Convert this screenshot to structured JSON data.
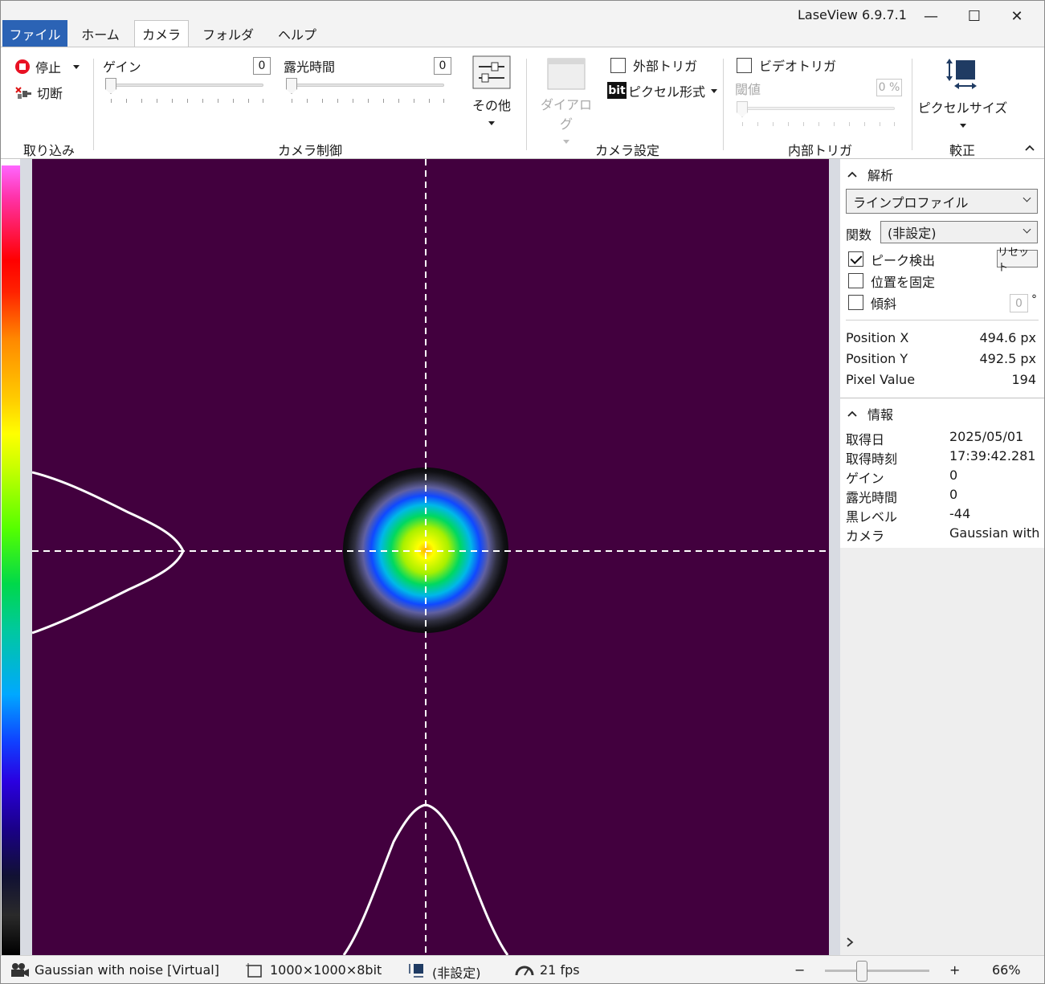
{
  "window": {
    "title": "LaseView 6.9.7.1",
    "minimize": "—",
    "maximize": "☐",
    "close": "✕"
  },
  "tabs": [
    {
      "label": "ファイル"
    },
    {
      "label": "ホーム"
    },
    {
      "label": "カメラ"
    },
    {
      "label": "フォルダ"
    },
    {
      "label": "ヘルプ"
    }
  ],
  "ribbon": {
    "capture": {
      "stop_label": "停止",
      "disconnect_label": "切断",
      "group_label": "取り込み"
    },
    "camera_control": {
      "gain_label": "ゲイン",
      "gain_value": "0",
      "exposure_label": "露光時間",
      "exposure_value": "0",
      "other_label": "その他",
      "group_label": "カメラ制御"
    },
    "camera_settings": {
      "dialog_label": "ダイアログ",
      "external_trigger_label": "外部トリガ",
      "bit_icon_text": "bit",
      "pixel_format_label": "ピクセル形式",
      "group_label": "カメラ設定"
    },
    "internal_trigger": {
      "video_trigger_label": "ビデオトリガ",
      "threshold_label": "閾値",
      "threshold_value": "0 %",
      "group_label": "内部トリガ"
    },
    "calibration": {
      "pixel_size_label": "ピクセルサイズ",
      "group_label": "較正"
    }
  },
  "analysis": {
    "section_title": "解析",
    "mode": "ラインプロファイル",
    "function_label": "関数",
    "function_value": "(非設定)",
    "peak_detect_label": "ピーク検出",
    "peak_detect_checked": true,
    "reset_label": "リセット",
    "fix_position_label": "位置を固定",
    "tilt_label": "傾斜",
    "tilt_value": "0",
    "tilt_unit": "°",
    "readouts": [
      {
        "key": "Position X",
        "value": "494.6 px"
      },
      {
        "key": "Position Y",
        "value": "492.5 px"
      },
      {
        "key": "Pixel Value",
        "value": "194"
      }
    ]
  },
  "info": {
    "section_title": "情報",
    "rows": [
      {
        "key": "取得日",
        "value": "2025/05/01"
      },
      {
        "key": "取得時刻",
        "value": "17:39:42.281"
      },
      {
        "key": "ゲイン",
        "value": "0"
      },
      {
        "key": "露光時間",
        "value": "0"
      },
      {
        "key": "黒レベル",
        "value": "-44"
      },
      {
        "key": "カメラ",
        "value": "Gaussian with"
      }
    ]
  },
  "statusbar": {
    "camera_name": "Gaussian with noise [Virtual]",
    "resolution": "1000×1000×8bit",
    "pixel_size": "(非設定)",
    "fps": "21 fps",
    "zoom_minus": "−",
    "zoom_plus": "+",
    "zoom_level": "66%",
    "zoom_fraction": 0.35
  },
  "colors": {
    "file_tab": "#2b63b5",
    "image_background": "#42003e",
    "stop_icon": "#e81123",
    "pixel_size_icon": "#1f3b63"
  }
}
